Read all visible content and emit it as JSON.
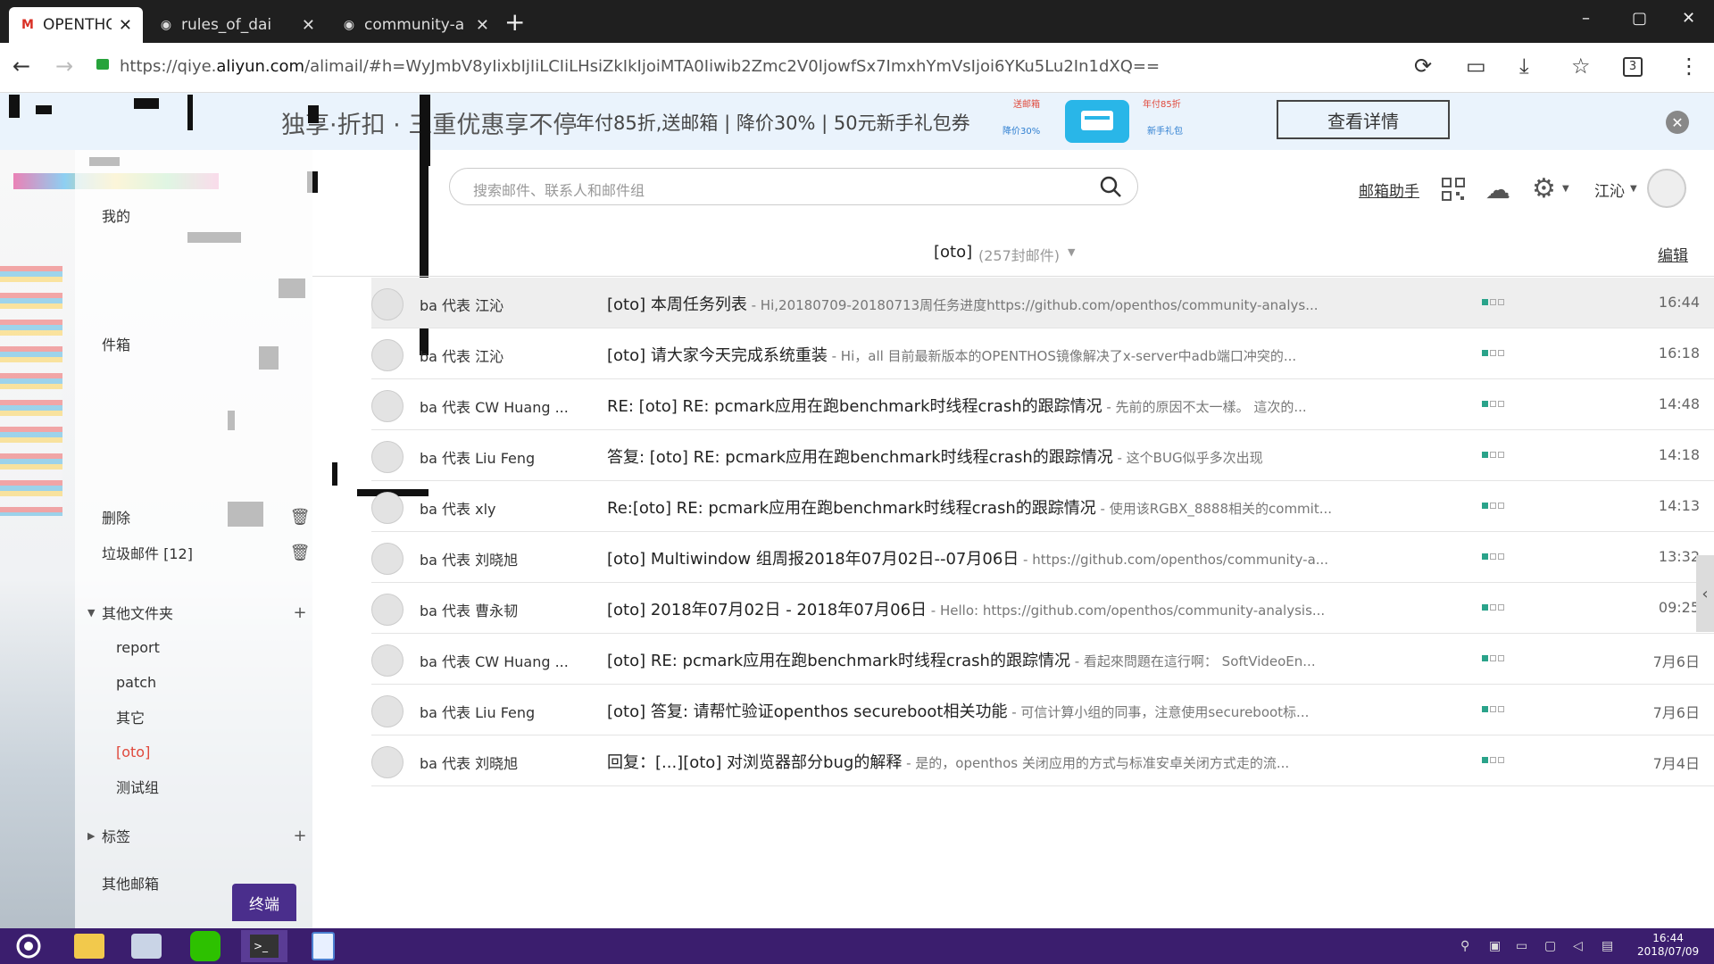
{
  "browser": {
    "tabs": [
      {
        "title": "OPENTHOS",
        "active": true
      },
      {
        "title": "rules_of_dai",
        "active": false
      },
      {
        "title": "community-a",
        "active": false
      }
    ],
    "url_prefix": "https://qiye.",
    "url_domain": "aliyun.com",
    "url_suffix": "/alimail/#h=WyJmbV8yIixbIjIiLCIiLHsiZkIkIjoiMTA0Iiwib2Zmc2V0IjowfSx7ImxhYmVsIjoi6YKu5Lu2In1dXQ==",
    "toolbar_badge": "3"
  },
  "banner": {
    "headline": "独享·折扣 · 三重优惠享不停",
    "offer": "年付85折,送邮箱 | 降价30% | 50元新手礼包券",
    "cta": "查看详情",
    "art_tags": [
      "送邮箱",
      "年付85折",
      "降价30%",
      "新手礼包"
    ]
  },
  "sidebar": {
    "folders_partial": [
      {
        "label": "我的",
        "has_delete": false
      },
      {
        "label": "件箱",
        "has_delete": false
      },
      {
        "label": "删除",
        "has_delete": true
      }
    ],
    "junk": {
      "label": "垃圾邮件 [12]"
    },
    "other_folders": {
      "label": "其他文件夹",
      "items": [
        "report",
        "patch",
        "其它",
        "[oto]",
        "测试组"
      ],
      "active": "[oto]"
    },
    "tags": {
      "label": "标签"
    },
    "other_mailboxes": {
      "label": "其他邮箱"
    }
  },
  "header": {
    "search_placeholder": "搜索邮件、联系人和邮件组",
    "help_link": "邮箱助手",
    "user_name": "江沁"
  },
  "list": {
    "folder": "[oto]",
    "count": "(257封邮件)",
    "edit": "编辑",
    "rows": [
      {
        "from": "ba 代表 江沁",
        "subject": "[oto] 本周任务列表",
        "preview": " - Hi,20180709-20180713周任务进度https://github.com/openthos/community-analys...",
        "time": "16:44",
        "selected": true
      },
      {
        "from": "ba 代表 江沁",
        "subject": "[oto] 请大家今天完成系统重装",
        "preview": " - Hi，all 目前最新版本的OPENTHOS镜像解决了x-server中adb端口冲突的...",
        "time": "16:18",
        "selected": false
      },
      {
        "from": "ba 代表 CW Huang ...",
        "subject": "RE: [oto] RE: pcmark应用在跑benchmark时线程crash的跟踪情况",
        "preview": " - 先前的原因不太一樣。   這次的...",
        "time": "14:48",
        "selected": false
      },
      {
        "from": "ba 代表 Liu Feng",
        "subject": "答复: [oto] RE: pcmark应用在跑benchmark时线程crash的跟踪情况",
        "preview": " - 这个BUG似乎多次出现",
        "time": "14:18",
        "selected": false
      },
      {
        "from": "ba 代表 xly",
        "subject": "Re:[oto] RE: pcmark应用在跑benchmark时线程crash的跟踪情况",
        "preview": " - 使用该RGBX_8888相关的commit...",
        "time": "14:13",
        "selected": false
      },
      {
        "from": "ba 代表 刘晓旭",
        "subject": "[oto] Multiwindow 组周报2018年07月02日--07月06日",
        "preview": " - https://github.com/openthos/community-a...",
        "time": "13:32",
        "selected": false
      },
      {
        "from": "ba 代表 曹永韧",
        "subject": "[oto] 2018年07月02日 - 2018年07月06日",
        "preview": " - Hello: https://github.com/openthos/community-analysis...",
        "time": "09:25",
        "selected": false
      },
      {
        "from": "ba 代表 CW Huang ...",
        "subject": "[oto] RE: pcmark应用在跑benchmark时线程crash的跟踪情况",
        "preview": " - 看起來問題在這行啊：   SoftVideoEn...",
        "time": "7月6日",
        "selected": false
      },
      {
        "from": "ba 代表 Liu Feng",
        "subject": "[oto] 答复: 请帮忙验证openthos secureboot相关功能",
        "preview": " - 可信计算小组的同事，注意使用secureboot标...",
        "time": "7月6日",
        "selected": false
      },
      {
        "from": "ba 代表 刘晓旭",
        "subject": "回复：[...][oto] 对浏览器部分bug的解释",
        "preview": " - 是的，openthos 关闭应用的方式与标准安卓关闭方式走的流...",
        "time": "7月4日",
        "selected": false
      }
    ]
  },
  "terminal_button": "终端",
  "taskbar": {
    "apps": [
      "openthos-start-icon",
      "file-manager-icon",
      "mail-app-icon",
      "wechat-icon",
      "terminal-icon",
      "notes-icon"
    ],
    "clock_time": "16:44",
    "clock_date": "2018/07/09"
  },
  "colors": {
    "taskbar": "#3b1e6e",
    "accent_red": "#e0483b",
    "flag_green": "#2aa38a"
  }
}
